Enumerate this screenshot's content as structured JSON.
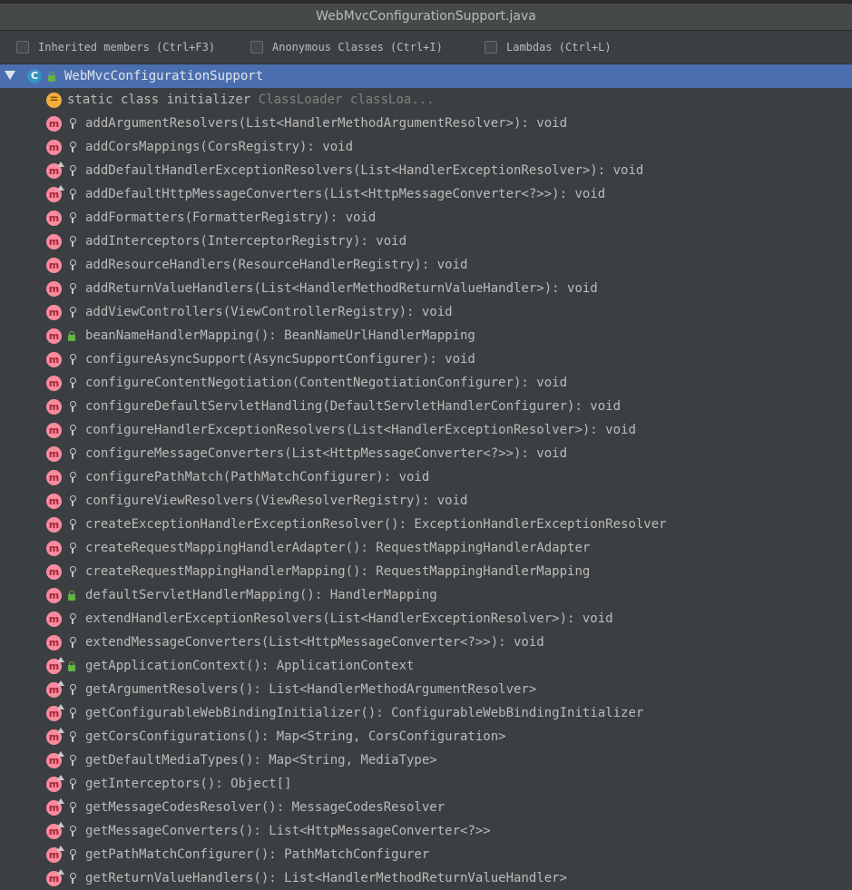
{
  "window": {
    "title": "WebMvcConfigurationSupport.java"
  },
  "filters": [
    {
      "label": "Inherited members (Ctrl+F3)"
    },
    {
      "label": "Anonymous Classes (Ctrl+I)"
    },
    {
      "label": "Lambdas (Ctrl+L)"
    }
  ],
  "root": {
    "label": "WebMvcConfigurationSupport",
    "icon": "class-icon"
  },
  "initializer": {
    "prefix": "static class initializer",
    "suffix": "ClassLoader classLoa..."
  },
  "members": [
    {
      "text": "addArgumentResolvers(List<HandlerMethodArgumentResolver>): void",
      "vis": "protected",
      "override": false
    },
    {
      "text": "addCorsMappings(CorsRegistry): void",
      "vis": "protected",
      "override": false
    },
    {
      "text": "addDefaultHandlerExceptionResolvers(List<HandlerExceptionResolver>): void",
      "vis": "protected",
      "override": true
    },
    {
      "text": "addDefaultHttpMessageConverters(List<HttpMessageConverter<?>>): void",
      "vis": "protected",
      "override": true
    },
    {
      "text": "addFormatters(FormatterRegistry): void",
      "vis": "protected",
      "override": false
    },
    {
      "text": "addInterceptors(InterceptorRegistry): void",
      "vis": "protected",
      "override": false
    },
    {
      "text": "addResourceHandlers(ResourceHandlerRegistry): void",
      "vis": "protected",
      "override": false
    },
    {
      "text": "addReturnValueHandlers(List<HandlerMethodReturnValueHandler>): void",
      "vis": "protected",
      "override": false
    },
    {
      "text": "addViewControllers(ViewControllerRegistry): void",
      "vis": "protected",
      "override": false
    },
    {
      "text": "beanNameHandlerMapping(): BeanNameUrlHandlerMapping",
      "vis": "public",
      "override": false
    },
    {
      "text": "configureAsyncSupport(AsyncSupportConfigurer): void",
      "vis": "protected",
      "override": false
    },
    {
      "text": "configureContentNegotiation(ContentNegotiationConfigurer): void",
      "vis": "protected",
      "override": false
    },
    {
      "text": "configureDefaultServletHandling(DefaultServletHandlerConfigurer): void",
      "vis": "protected",
      "override": false
    },
    {
      "text": "configureHandlerExceptionResolvers(List<HandlerExceptionResolver>): void",
      "vis": "protected",
      "override": false
    },
    {
      "text": "configureMessageConverters(List<HttpMessageConverter<?>>): void",
      "vis": "protected",
      "override": false
    },
    {
      "text": "configurePathMatch(PathMatchConfigurer): void",
      "vis": "protected",
      "override": false
    },
    {
      "text": "configureViewResolvers(ViewResolverRegistry): void",
      "vis": "protected",
      "override": false
    },
    {
      "text": "createExceptionHandlerExceptionResolver(): ExceptionHandlerExceptionResolver",
      "vis": "protected",
      "override": false
    },
    {
      "text": "createRequestMappingHandlerAdapter(): RequestMappingHandlerAdapter",
      "vis": "protected",
      "override": false
    },
    {
      "text": "createRequestMappingHandlerMapping(): RequestMappingHandlerMapping",
      "vis": "protected",
      "override": false
    },
    {
      "text": "defaultServletHandlerMapping(): HandlerMapping",
      "vis": "public",
      "override": false
    },
    {
      "text": "extendHandlerExceptionResolvers(List<HandlerExceptionResolver>): void",
      "vis": "protected",
      "override": false
    },
    {
      "text": "extendMessageConverters(List<HttpMessageConverter<?>>): void",
      "vis": "protected",
      "override": false
    },
    {
      "text": "getApplicationContext(): ApplicationContext",
      "vis": "public",
      "override": true
    },
    {
      "text": "getArgumentResolvers(): List<HandlerMethodArgumentResolver>",
      "vis": "protected",
      "override": true
    },
    {
      "text": "getConfigurableWebBindingInitializer(): ConfigurableWebBindingInitializer",
      "vis": "protected",
      "override": true
    },
    {
      "text": "getCorsConfigurations(): Map<String, CorsConfiguration>",
      "vis": "protected",
      "override": true
    },
    {
      "text": "getDefaultMediaTypes(): Map<String, MediaType>",
      "vis": "protected",
      "override": true
    },
    {
      "text": "getInterceptors(): Object[]",
      "vis": "protected",
      "override": true
    },
    {
      "text": "getMessageCodesResolver(): MessageCodesResolver",
      "vis": "protected",
      "override": true
    },
    {
      "text": "getMessageConverters(): List<HttpMessageConverter<?>>",
      "vis": "protected",
      "override": true
    },
    {
      "text": "getPathMatchConfigurer(): PathMatchConfigurer",
      "vis": "protected",
      "override": true
    },
    {
      "text": "getReturnValueHandlers(): List<HandlerMethodReturnValueHandler>",
      "vis": "protected",
      "override": true
    }
  ],
  "colors": {
    "selection": "#4b6eaf",
    "background": "#3c3f41",
    "method_icon": "#f98b9e",
    "initializer_icon": "#f4af3d",
    "public_lock": "#62b543"
  }
}
